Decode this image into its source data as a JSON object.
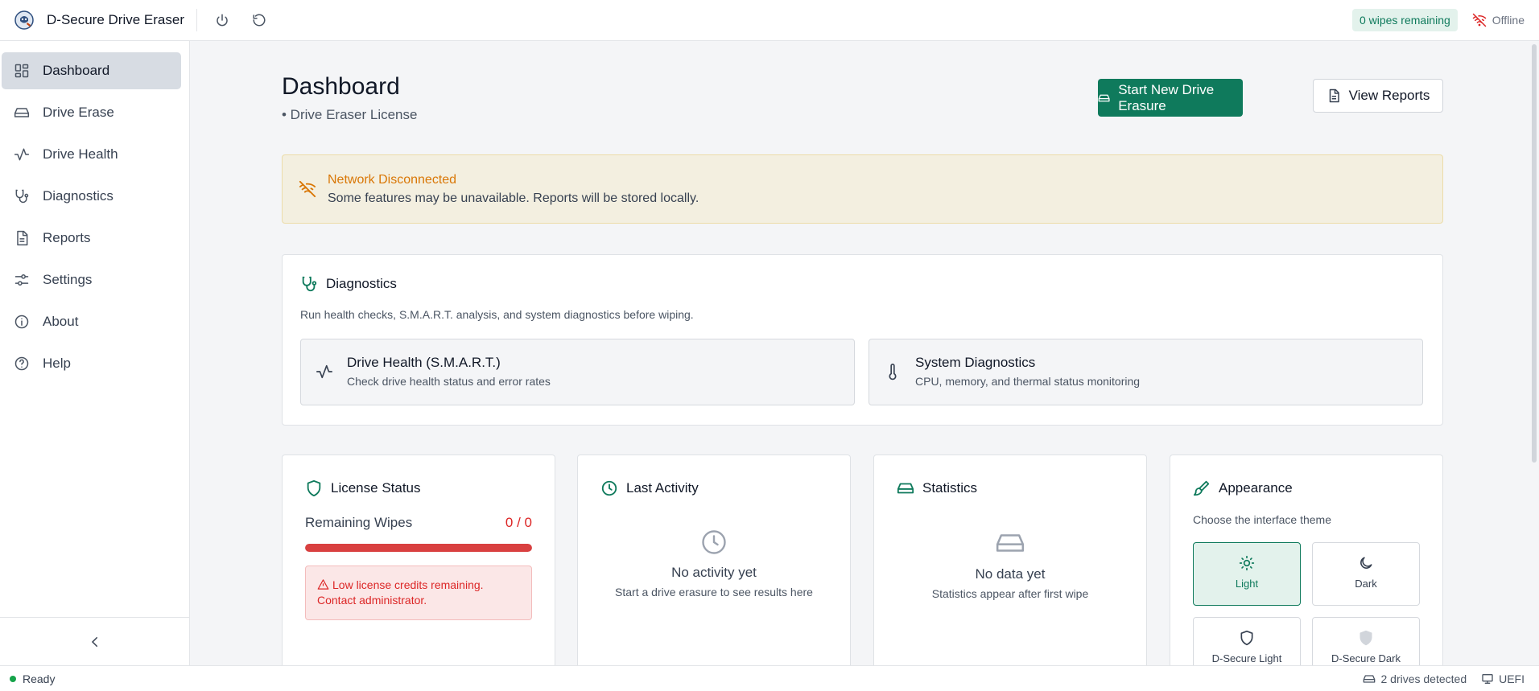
{
  "app": {
    "title": "D-Secure Drive Eraser"
  },
  "topbar": {
    "wipes_badge": "0 wipes remaining",
    "network_status": "Offline"
  },
  "sidebar": {
    "items": [
      {
        "label": "Dashboard",
        "icon": "dashboard-icon",
        "active": true
      },
      {
        "label": "Drive Erase",
        "icon": "drive-icon"
      },
      {
        "label": "Drive Health",
        "icon": "activity-icon"
      },
      {
        "label": "Diagnostics",
        "icon": "stethoscope-icon"
      },
      {
        "label": "Reports",
        "icon": "document-icon"
      },
      {
        "label": "Settings",
        "icon": "sliders-icon"
      },
      {
        "label": "About",
        "icon": "info-icon"
      },
      {
        "label": "Help",
        "icon": "help-icon"
      }
    ]
  },
  "header": {
    "title": "Dashboard",
    "subtitle": "• Drive Eraser License",
    "primary_action": "Start New Drive Erasure",
    "secondary_action": "View Reports"
  },
  "alert": {
    "title": "Network Disconnected",
    "text": "Some features may be unavailable. Reports will be stored locally."
  },
  "diagnostics": {
    "title": "Diagnostics",
    "description": "Run health checks, S.M.A.R.T. analysis, and system diagnostics before wiping.",
    "cards": [
      {
        "title": "Drive Health (S.M.A.R.T.)",
        "description": "Check drive health status and error rates"
      },
      {
        "title": "System Diagnostics",
        "description": "CPU, memory, and thermal status monitoring"
      }
    ]
  },
  "license": {
    "title": "License Status",
    "remaining_label": "Remaining Wipes",
    "remaining_value": "0 / 0",
    "usage_fraction": 1.0,
    "warning": "Low license credits remaining. Contact administrator."
  },
  "activity": {
    "title": "Last Activity",
    "empty_title": "No activity yet",
    "empty_sub": "Start a drive erasure to see results here"
  },
  "statistics": {
    "title": "Statistics",
    "empty_title": "No data yet",
    "empty_sub": "Statistics appear after first wipe"
  },
  "appearance": {
    "title": "Appearance",
    "description": "Choose the interface theme",
    "themes": [
      {
        "label": "Light",
        "icon": "sun-icon",
        "active": true
      },
      {
        "label": "Dark",
        "icon": "moon-icon"
      },
      {
        "label": "D-Secure Light",
        "icon": "shield-icon"
      },
      {
        "label": "D-Secure Dark",
        "icon": "shield-filled-icon"
      }
    ]
  },
  "statusbar": {
    "status": "Ready",
    "drives": "2 drives detected",
    "firmware": "UEFI"
  },
  "colors": {
    "accent": "#0f7a5c",
    "danger": "#d94040",
    "warning": "#d97706",
    "success": "#16a34a"
  }
}
